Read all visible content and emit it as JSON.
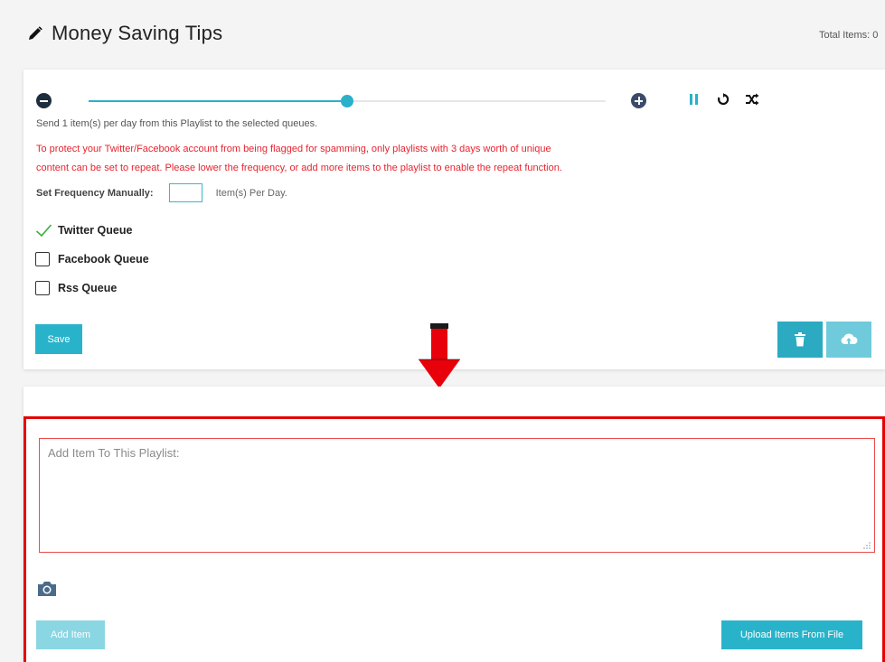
{
  "header": {
    "title": "Money Saving Tips",
    "total_items": "Total Items: 0"
  },
  "schedule": {
    "slider_level_percent": 50,
    "send_text": "Send 1 item(s) per day from this Playlist to the selected queues.",
    "warning_line1": "To protect your Twitter/Facebook account from being flagged for spamming, only playlists with 3 days worth of unique",
    "warning_line2": "content can be set to repeat. Please lower the frequency, or add more items to the playlist to enable the repeat function.",
    "freq_label": "Set Frequency Manually:",
    "freq_value": "",
    "freq_suffix": "Item(s) Per Day."
  },
  "queues": [
    {
      "label": "Twitter Queue",
      "checked": true
    },
    {
      "label": "Facebook Queue",
      "checked": false
    },
    {
      "label": "Rss Queue",
      "checked": false
    }
  ],
  "buttons": {
    "save": "Save",
    "add_item": "Add Item",
    "upload": "Upload Items From File"
  },
  "add_item": {
    "placeholder": "Add Item To This Playlist:"
  },
  "icons": {
    "title": "pencil-icon",
    "minus": "minus-circle-icon",
    "plus": "plus-circle-icon",
    "pause": "pause-icon",
    "repeat": "repeat-icon",
    "shuffle": "shuffle-icon",
    "trash": "trash-icon",
    "upload": "cloud-upload-icon",
    "camera": "camera-icon",
    "check": "check-icon"
  },
  "colors": {
    "accent": "#29b3cb",
    "warning": "#e8232e",
    "highlight": "#e60000"
  }
}
